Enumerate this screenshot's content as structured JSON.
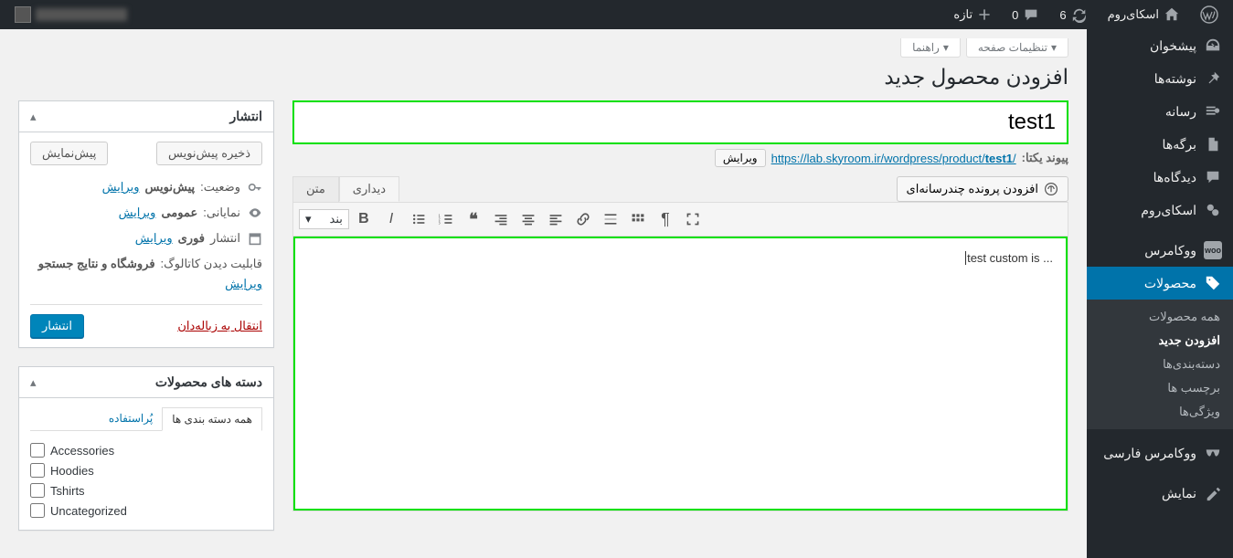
{
  "adminbar": {
    "site_name": "اسکای‌روم",
    "updates_count": "6",
    "comments_count": "0",
    "new_label": "تازه",
    "user_greeting": ""
  },
  "sidebar": {
    "items": [
      {
        "label": "پیشخوان",
        "icon": "dashboard"
      },
      {
        "label": "نوشته‌ها",
        "icon": "pin"
      },
      {
        "label": "رسانه",
        "icon": "media"
      },
      {
        "label": "برگه‌ها",
        "icon": "pages"
      },
      {
        "label": "دیدگاه‌ها",
        "icon": "comments"
      },
      {
        "label": "اسکای‌روم",
        "icon": "skyroom"
      },
      {
        "label": "ووکامرس",
        "icon": "woo"
      },
      {
        "label": "محصولات",
        "icon": "products",
        "active": true
      },
      {
        "label": "ووکامرس فارسی",
        "icon": "woo-fa"
      },
      {
        "label": "نمایش",
        "icon": "appearance"
      }
    ],
    "submenu": [
      {
        "label": "همه محصولات"
      },
      {
        "label": "افزودن جدید",
        "current": true
      },
      {
        "label": "دسته‌بندی‌ها"
      },
      {
        "label": "برچسب ها"
      },
      {
        "label": "ویژگی‌ها"
      }
    ]
  },
  "screen": {
    "help": "راهنما",
    "options": "تنظیمات صفحه"
  },
  "page": {
    "title": "افزودن محصول جدید",
    "post_title": "test1",
    "permalink_label": "پیوند یکتا:",
    "permalink_base": "https://lab.skyroom.ir/wordpress/product/",
    "permalink_slug": "test1",
    "edit_btn": "ویرایش",
    "content": "... test custom is"
  },
  "editor": {
    "add_media": "افزودن پرونده چندرسانه‌ای",
    "tab_visual": "دیداری",
    "tab_text": "متن",
    "paragraph": "بند"
  },
  "publish": {
    "box_title": "انتشار",
    "save_draft": "ذخیره پیش‌نویس",
    "preview": "پیش‌نمایش",
    "status_label": "وضعیت:",
    "status_value": "پیش‌نویس",
    "visibility_label": "نمایانی:",
    "visibility_value": "عمومی",
    "schedule_label": "انتشار",
    "schedule_value": "فوری",
    "catalog_label": "قابلیت دیدن کاتالوگ:",
    "catalog_value": "فروشگاه و نتایج جستجو",
    "edit_link": "ویرایش",
    "trash": "انتقال به زباله‌دان",
    "publish_btn": "انتشار"
  },
  "categories": {
    "box_title": "دسته های محصولات",
    "tab_all": "همه دسته بندی ها",
    "tab_used": "پُراستفاده",
    "items": [
      "Accessories",
      "Hoodies",
      "Tshirts",
      "Uncategorized"
    ]
  }
}
